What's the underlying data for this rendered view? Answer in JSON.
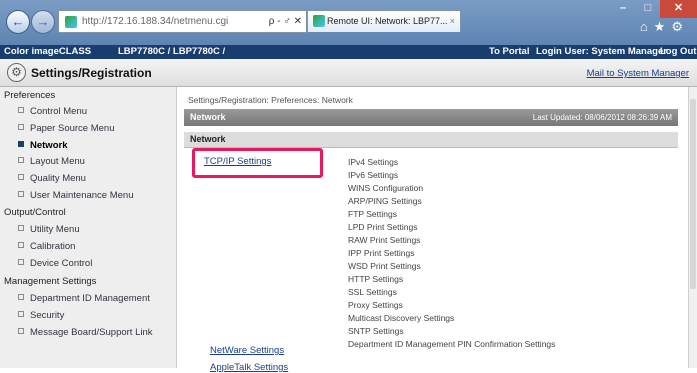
{
  "browser": {
    "address": "http://172.16.188.34/netmenu.cgi",
    "address_controls": "ρ - ♂ ✕",
    "tab_title": "Remote UI: Network: LBP77...",
    "tab_close": "×",
    "back_glyph": "←",
    "forward_glyph": "→",
    "minimize": "–",
    "maximize": "□",
    "close": "✕",
    "toolbar_icons": "⌂★⚙"
  },
  "app": {
    "product": "Color imageCLASS",
    "model": "LBP7780C / LBP7780C /",
    "to_portal": "To Portal",
    "login_user": "Login User: System Manager",
    "logout": "Log Out",
    "header_title": "Settings/Registration",
    "mail_link": "Mail to System Manager"
  },
  "sidebar": {
    "preferences": "Preferences",
    "control_menu": "Control Menu",
    "paper_source_menu": "Paper Source Menu",
    "network": "Network",
    "layout_menu": "Layout Menu",
    "quality_menu": "Quality Menu",
    "user_maintenance_menu": "User Maintenance Menu",
    "output_control": "Output/Control",
    "utility_menu": "Utility Menu",
    "calibration": "Calibration",
    "device_control": "Device Control",
    "management_settings": "Management Settings",
    "department_id_management": "Department ID Management",
    "security": "Security",
    "message_board": "Message Board/Support Link"
  },
  "main": {
    "breadcrumb": "Settings/Registration: Preferences: Network",
    "section_title": "Network",
    "last_updated": "Last Updated: 08/06/2012 08:26:39 AM",
    "subsection": "Network",
    "tcpip_link": "TCP/IP Settings",
    "netware_link": "NetWare Settings",
    "appletalk_link": "AppleTalk Settings",
    "tcpip_items": {
      "ipv4": "IPv4 Settings",
      "ipv6": "IPv6 Settings",
      "wins": "WINS Configuration",
      "arp_ping": "ARP/PING Settings",
      "ftp": "FTP Settings",
      "lpd": "LPD Print Settings",
      "raw": "RAW Print Settings",
      "ipp": "IPP Print Settings",
      "wsd": "WSD Print Settings",
      "http": "HTTP Settings",
      "ssl": "SSL Settings",
      "proxy": "Proxy Settings",
      "multicast": "Multicast Discovery Settings",
      "sntp": "SNTP Settings",
      "dept_pin": "Department ID Management PIN Confirmation Settings"
    }
  },
  "colors": {
    "highlight": "#e8195e",
    "app_bar": "#1a3d6f",
    "link": "#1a3d8f"
  }
}
